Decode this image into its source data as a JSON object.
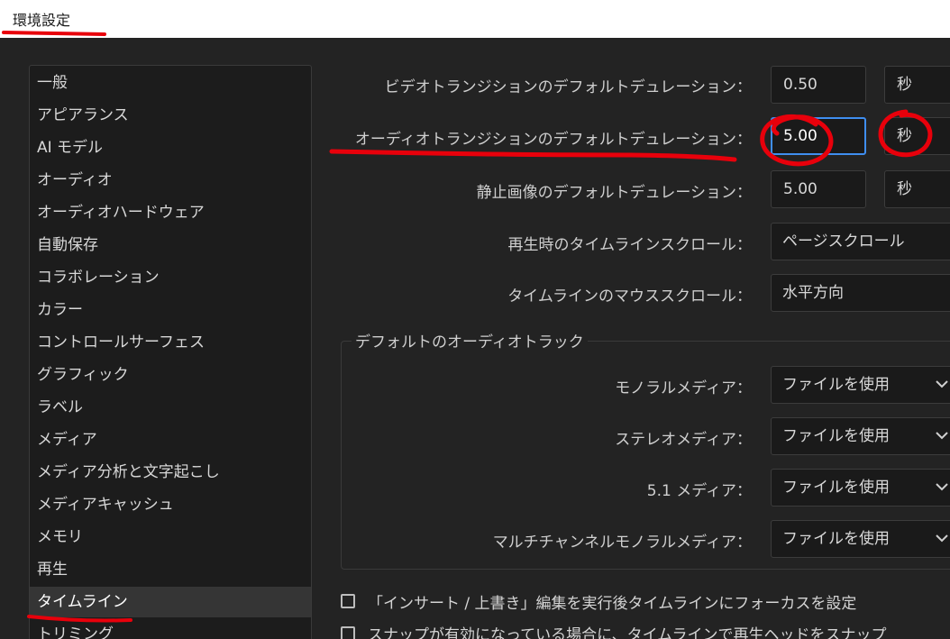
{
  "window": {
    "title": "環境設定"
  },
  "sidebar": {
    "items": [
      {
        "label": "一般"
      },
      {
        "label": "アピアランス"
      },
      {
        "label": "AI モデル"
      },
      {
        "label": "オーディオ"
      },
      {
        "label": "オーディオハードウェア"
      },
      {
        "label": "自動保存"
      },
      {
        "label": "コラボレーション"
      },
      {
        "label": "カラー"
      },
      {
        "label": "コントロールサーフェス"
      },
      {
        "label": "グラフィック"
      },
      {
        "label": "ラベル"
      },
      {
        "label": "メディア"
      },
      {
        "label": "メディア分析と文字起こし"
      },
      {
        "label": "メディアキャッシュ"
      },
      {
        "label": "メモリ"
      },
      {
        "label": "再生"
      },
      {
        "label": "タイムライン",
        "selected": true
      },
      {
        "label": "トリミング"
      }
    ]
  },
  "settings": {
    "video_transition": {
      "label": "ビデオトランジションのデフォルトデュレーション：",
      "value": "0.50",
      "unit": "秒"
    },
    "audio_transition": {
      "label": "オーディオトランジションのデフォルトデュレーション：",
      "value": "5.00",
      "unit": "秒"
    },
    "still_image": {
      "label": "静止画像のデフォルトデュレーション：",
      "value": "5.00",
      "unit": "秒"
    },
    "playback_scroll": {
      "label": "再生時のタイムラインスクロール：",
      "value": "ページスクロール"
    },
    "mouse_scroll": {
      "label": "タイムラインのマウススクロール：",
      "value": "水平方向"
    }
  },
  "audio_track_group": {
    "title": "デフォルトのオーディオトラック",
    "rows": [
      {
        "label": "モノラルメディア：",
        "value": "ファイルを使用"
      },
      {
        "label": "ステレオメディア：",
        "value": "ファイルを使用"
      },
      {
        "label": "5.1 メディア：",
        "value": "ファイルを使用"
      },
      {
        "label": "マルチチャンネルモノラルメディア：",
        "value": "ファイルを使用"
      }
    ]
  },
  "checkboxes": [
    {
      "label": "「インサート / 上書き」編集を実行後タイムラインにフォーカスを設定",
      "checked": false
    },
    {
      "label": "スナップが有効になっている場合に、タイムラインで再生ヘッドをスナップ",
      "checked": false
    }
  ],
  "colors": {
    "accent": "#3f8ef0",
    "annotation": "#e8000b",
    "background": "#232323"
  }
}
